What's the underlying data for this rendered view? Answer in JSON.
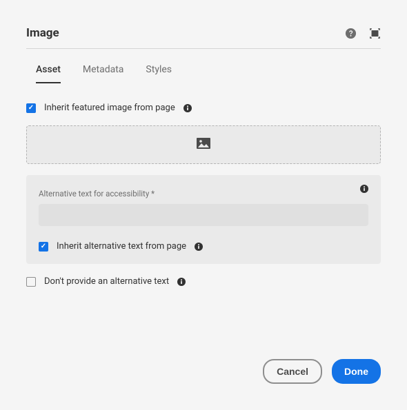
{
  "header": {
    "title": "Image"
  },
  "tabs": {
    "asset": "Asset",
    "metadata": "Metadata",
    "styles": "Styles"
  },
  "asset": {
    "inherit_featured_label": "Inherit featured image from page",
    "alt_text_label": "Alternative text for accessibility *",
    "alt_text_value": "",
    "inherit_alt_label": "Inherit alternative text from page",
    "no_alt_label": "Don't provide an alternative text"
  },
  "footer": {
    "cancel": "Cancel",
    "done": "Done"
  }
}
